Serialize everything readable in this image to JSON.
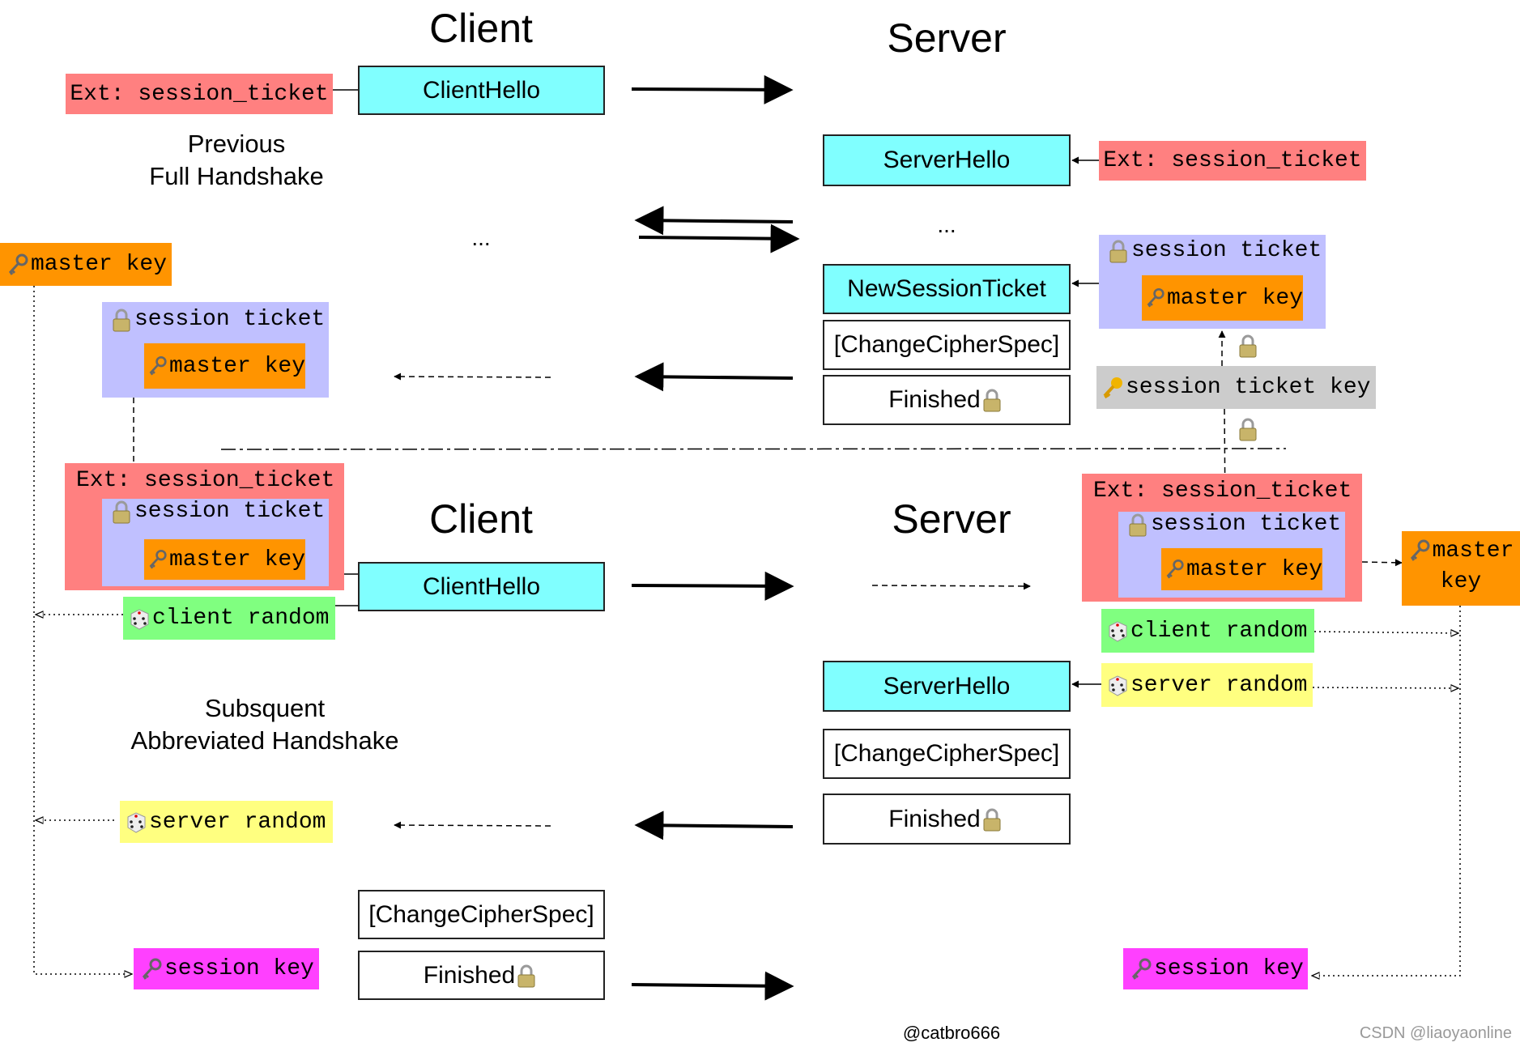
{
  "colors": {
    "message": "#80ffff",
    "extension": "#ff8080",
    "session_ticket": "#c0c0ff",
    "master_key": "#ff9400",
    "session_ticket_key": "#cccccc",
    "client_random": "#80ff80",
    "server_random": "#ffff80",
    "session_key": "#ff40ff"
  },
  "full": {
    "client_title": "Client",
    "server_title": "Server",
    "caption_line1": "Previous",
    "caption_line2": "Full Handshake",
    "client_ext": "Ext: session_ticket",
    "client_hello": "ClientHello",
    "server_hello": "ServerHello",
    "server_ext": "Ext: session_ticket",
    "ellipsis_client": "...",
    "ellipsis_server": "...",
    "client_master_key": "master key",
    "client_ticket": "session ticket",
    "client_ticket_master_key": "master key",
    "new_session_ticket": "NewSessionTicket",
    "server_ticket": "session ticket",
    "server_ticket_master_key": "master key",
    "change_cipher_spec": "[ChangeCipherSpec]",
    "finished": "Finished",
    "session_ticket_key": "session ticket key"
  },
  "abbrev": {
    "client_title": "Client",
    "server_title": "Server",
    "caption_line1": "Subsquent",
    "caption_line2": "Abbreviated Handshake",
    "client_ext": "Ext: session_ticket",
    "client_ticket": "session ticket",
    "client_ticket_master_key": "master key",
    "client_hello": "ClientHello",
    "client_random": "client random",
    "server_ext": "Ext: session_ticket",
    "server_ticket": "session ticket",
    "server_ticket_master_key": "master key",
    "server_master_key_line1": "master",
    "server_master_key_line2": "key",
    "server_client_random": "client random",
    "server_server_random": "server random",
    "server_hello": "ServerHello",
    "server_change_cipher_spec": "[ChangeCipherSpec]",
    "server_finished": "Finished",
    "client_server_random": "server random",
    "client_change_cipher_spec": "[ChangeCipherSpec]",
    "client_finished": "Finished",
    "client_session_key": "session key",
    "server_session_key": "session key"
  },
  "footer": {
    "credit": "@catbro666",
    "watermark": "CSDN @liaoyaonline"
  },
  "icons": {
    "key": "key-icon",
    "gold_key": "golden-key-icon",
    "lock": "lock-icon",
    "dice": "dice-icon"
  }
}
